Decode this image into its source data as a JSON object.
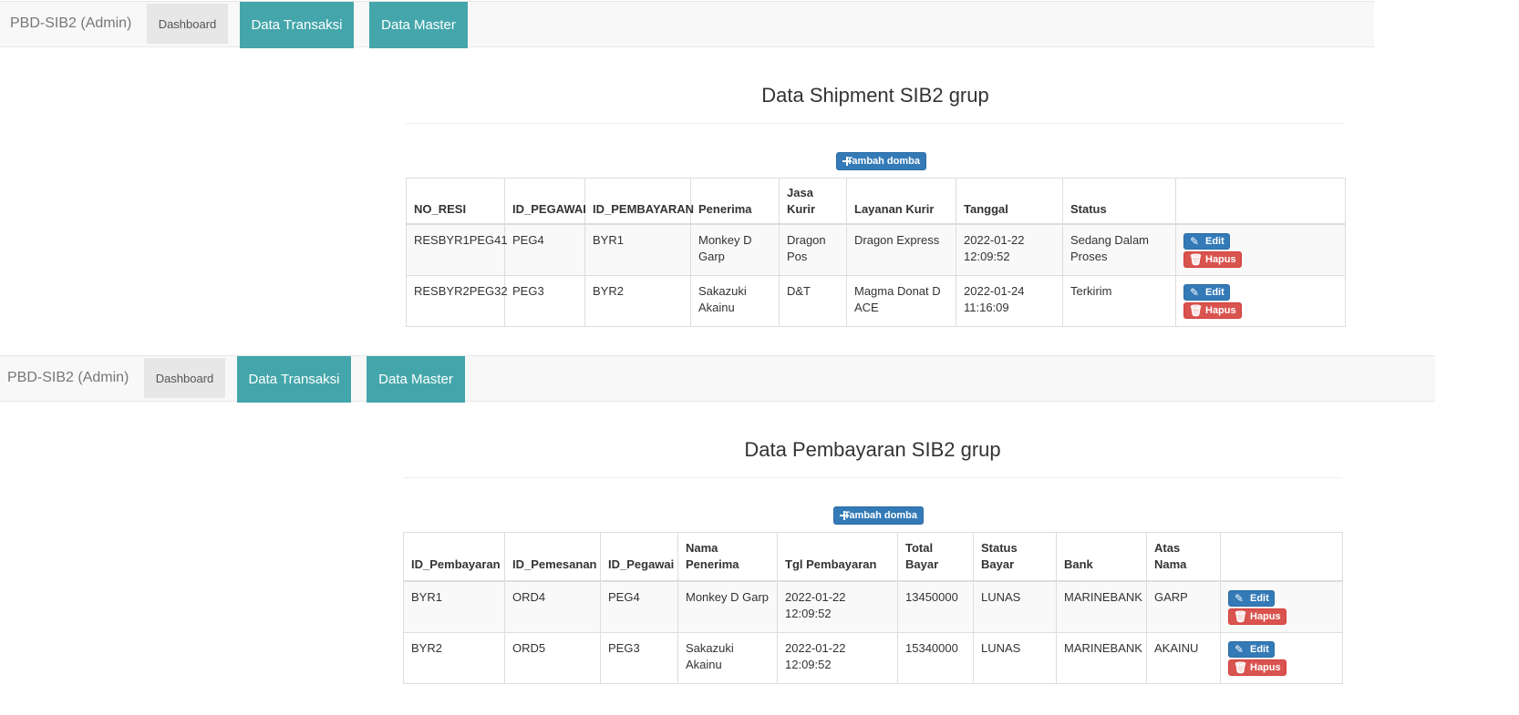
{
  "panel1": {
    "navbar": {
      "brand": "PBD-SIB2 (Admin)",
      "dashboard": "Dashboard",
      "transaksi": "Data Transaksi",
      "master": "Data Master"
    },
    "title": "Data Shipment SIB2 grup",
    "add_label": "Tambah domba",
    "table": {
      "headers": [
        "NO_RESI",
        "ID_PEGAWAI",
        "ID_PEMBAYARAN",
        "Penerima",
        "Jasa Kurir",
        "Layanan Kurir",
        "Tanggal",
        "Status",
        ""
      ],
      "rows": [
        [
          "RESBYR1PEG41",
          "PEG4",
          "BYR1",
          "Monkey D Garp",
          "Dragon Pos",
          "Dragon Express",
          "2022-01-22 12:09:52",
          "Sedang Dalam Proses"
        ],
        [
          "RESBYR2PEG32",
          "PEG3",
          "BYR2",
          "Sakazuki Akainu",
          "D&T",
          "Magma Donat D ACE",
          "2022-01-24 11:16:09",
          "Terkirim"
        ]
      ]
    }
  },
  "panel2": {
    "navbar": {
      "brand": "PBD-SIB2 (Admin)",
      "dashboard": "Dashboard",
      "transaksi": "Data Transaksi",
      "master": "Data Master"
    },
    "title": "Data Pembayaran SIB2 grup",
    "add_label": "Tambah domba",
    "table": {
      "headers": [
        "ID_Pembayaran",
        "ID_Pemesanan",
        "ID_Pegawai",
        "Nama Penerima",
        "Tgl Pembayaran",
        "Total Bayar",
        "Status Bayar",
        "Bank",
        "Atas Nama",
        ""
      ],
      "rows": [
        [
          "BYR1",
          "ORD4",
          "PEG4",
          "Monkey D Garp",
          "2022-01-22 12:09:52",
          "13450000",
          "LUNAS",
          "MARINEBANK",
          "GARP"
        ],
        [
          "BYR2",
          "ORD5",
          "PEG3",
          "Sakazuki Akainu",
          "2022-01-22 12:09:52",
          "15340000",
          "LUNAS",
          "MARINEBANK",
          "AKAINU"
        ]
      ]
    }
  },
  "actions": {
    "edit_label": "Edit",
    "delete_label": "Hapus",
    "edit_icon": "pencil-icon",
    "delete_icon": "trash-icon"
  },
  "colors": {
    "primary": "#337ab7",
    "danger": "#d9534f",
    "nav_teal": "#44a6ab",
    "navbar_bg": "#f8f8f8"
  }
}
